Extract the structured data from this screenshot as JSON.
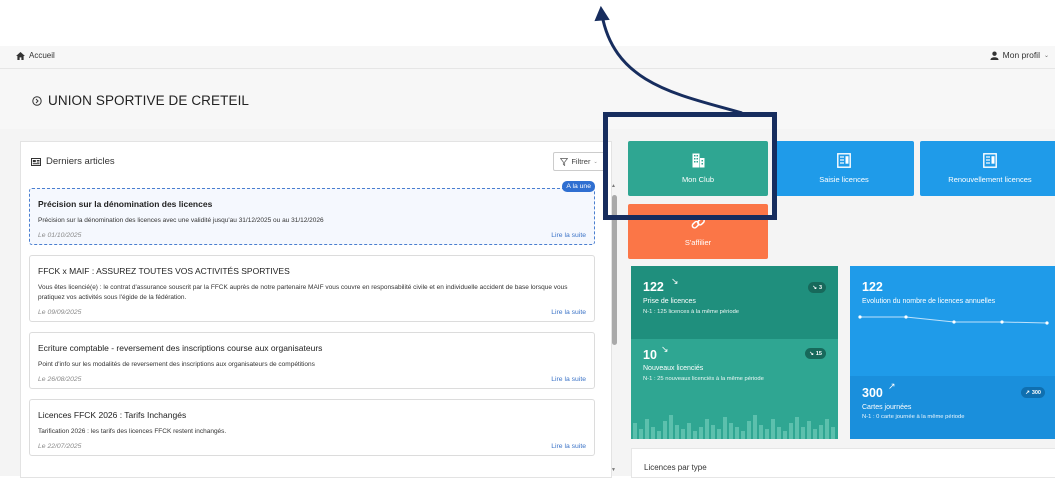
{
  "topbar": {
    "home_label": "Accueil",
    "profile_label": "Mon profil"
  },
  "page": {
    "title": "UNION SPORTIVE DE CRETEIL"
  },
  "articles": {
    "panel_title": "Derniers articles",
    "filter_label": "Filtrer",
    "items": [
      {
        "title": "Précision sur la dénomination des licences",
        "text": "Précision sur la dénomination des licences avec une validité jusqu'au 31/12/2025 ou au 31/12/2026",
        "date": "Le 01/10/2025",
        "read_more": "Lire la suite",
        "badge": "A la une"
      },
      {
        "title": "FFCK x MAIF : ASSUREZ TOUTES VOS ACTIVITÉS SPORTIVES",
        "text": "Vous êtes licencié(e) : le contrat d'assurance souscrit par la FFCK auprès de notre partenaire MAIF vous couvre en responsabilité civile et en individuelle accident de base lorsque vous pratiquez vos activités sous l'égide de la fédération.",
        "date": "Le 09/09/2025",
        "read_more": "Lire la suite"
      },
      {
        "title": "Ecriture comptable - reversement des inscriptions course aux organisateurs",
        "text": "Point d'info sur les modalités de reversement des inscriptions aux organisateurs de compétitions",
        "date": "Le 26/08/2025",
        "read_more": "Lire la suite"
      },
      {
        "title": "Licences FFCK 2026 : Tarifs Inchangés",
        "text": "Tarification 2026 : les tarifs des licences FFCK restent inchangés.",
        "date": "Le 22/07/2025",
        "read_more": "Lire la suite"
      }
    ]
  },
  "tiles": {
    "mon_club": {
      "label": "Mon Club",
      "icon": "building-icon",
      "color": "#2fa692"
    },
    "saisie": {
      "label": "Saisie licences",
      "icon": "license-card-icon",
      "color": "#1f9be9"
    },
    "renouvellement": {
      "label": "Renouvellement licences",
      "icon": "license-card-icon",
      "color": "#1f9be9"
    },
    "saffilier": {
      "label": "S'affilier",
      "icon": "link-icon",
      "color": "#fb7647"
    }
  },
  "stats": {
    "prise": {
      "value": "122",
      "label": "Prise de licences",
      "sub": "N-1 : 125 licences à la même période",
      "delta": "3",
      "trend": "down"
    },
    "nouveaux": {
      "value": "10",
      "label": "Nouveaux licenciés",
      "sub": "N-1 : 25 nouveaux licenciés à la même période",
      "delta": "15",
      "trend": "down"
    },
    "evolution": {
      "value": "122",
      "label": "Evolution du nombre de licences annuelles"
    },
    "cartes": {
      "value": "300",
      "label": "Cartes journées",
      "sub": "N-1 : 0 carte journée à la même période",
      "delta": "300",
      "trend": "up"
    }
  },
  "licences_par_type": {
    "title": "Licences par type"
  }
}
